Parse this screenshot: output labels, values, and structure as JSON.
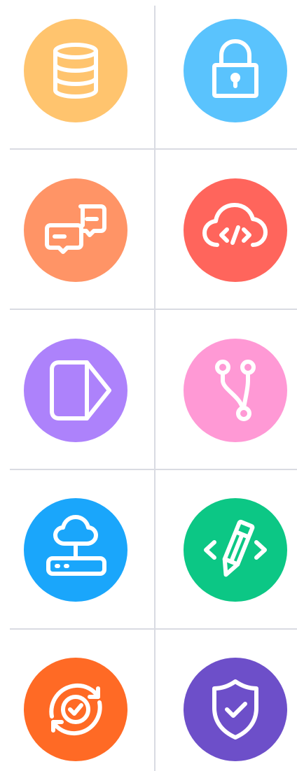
{
  "icons": [
    {
      "name": "database-icon",
      "color": "#ffc46e"
    },
    {
      "name": "padlock-icon",
      "color": "#5ac3fd"
    },
    {
      "name": "chat-bubbles-icon",
      "color": "#ff9466"
    },
    {
      "name": "cloud-code-icon",
      "color": "#ff655c"
    },
    {
      "name": "document-tag-icon",
      "color": "#ad82fb"
    },
    {
      "name": "git-branch-icon",
      "color": "#ff99d5"
    },
    {
      "name": "cloud-server-icon",
      "color": "#1aa6fb"
    },
    {
      "name": "pencil-code-icon",
      "color": "#0cc785"
    },
    {
      "name": "sync-check-icon",
      "color": "#ff6a25"
    },
    {
      "name": "shield-check-icon",
      "color": "#6d4fc9"
    }
  ]
}
